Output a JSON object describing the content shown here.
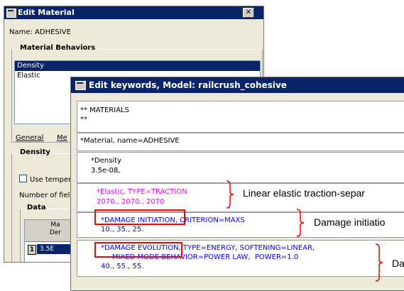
{
  "edit_material": {
    "title": "Edit Material",
    "close_label": "✕",
    "name_line": "Name:  ADHESIVE",
    "behaviors_heading": "Material Behaviors",
    "behaviors": [
      "Density",
      "Elastic"
    ],
    "selected_behavior_index": 0,
    "tabs": [
      "General",
      "Me"
    ],
    "density_heading": "Density",
    "use_temperature": "Use temper",
    "number_of_fields": "Number of fiel",
    "data_heading": "Data",
    "table_header": "Ma\nDer",
    "row_index": "1",
    "row_value": "3.5E"
  },
  "edit_keywords": {
    "title": "Edit keywords, Model: railcrush_cohesive",
    "blocks": {
      "materials": [
        "** MATERIALS",
        "**"
      ],
      "material": "*Material, name=ADHESIVE",
      "density": [
        "*Density",
        "3.5e-08,"
      ],
      "elastic": [
        "*Elastic, TYPE=TRACTION",
        "2070., 2070., 2070"
      ],
      "damage_initiation": {
        "keyword": "*DAMAGE INITIATION,",
        "rest": " CRITERION=MAXS",
        "values": "10., 35., 25."
      },
      "damage_evolution": {
        "keyword": "*DAMAGE EVOLUTION,",
        "rest": " TYPE=ENERGY, SOFTENING=LINEAR,",
        "line2": "     MIXED MODE BEHAVIOR=POWER LAW,  POWER=1.0",
        "values": "40., 55., 55."
      }
    }
  },
  "annotations": {
    "elastic": "Linear elastic traction-separ",
    "initiation": "Damage initiatio",
    "evolution": "Da"
  },
  "colors": {
    "title_bar": "#0a246a",
    "keyword_magenta": "#ff00ff",
    "keyword_blue": "#0000ff",
    "highlight_red": "#ff0000"
  }
}
